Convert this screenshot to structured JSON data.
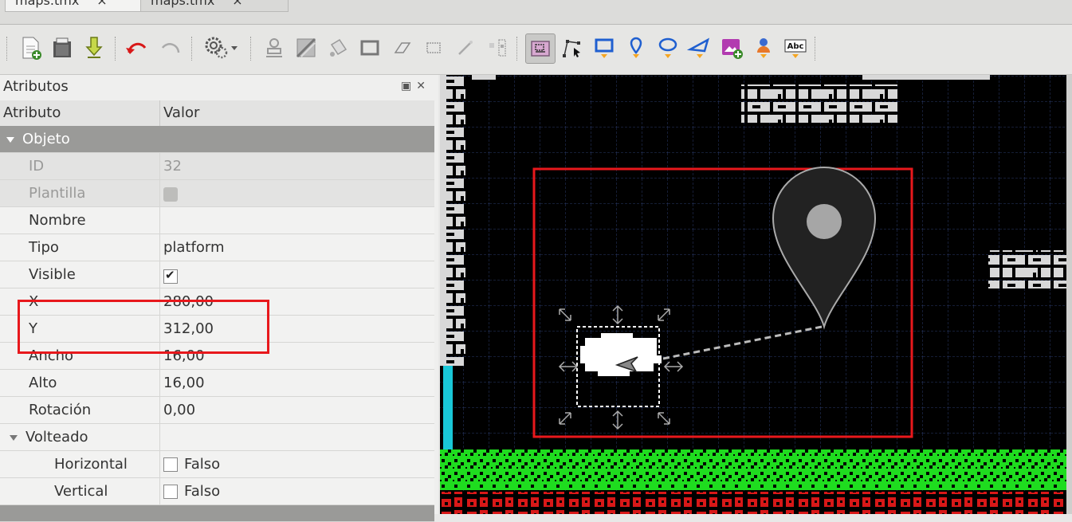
{
  "tabs": [
    {
      "label": "maps.tmx",
      "close": "×"
    },
    {
      "label": "maps.tmx",
      "close": "×"
    }
  ],
  "toolbar": {
    "icons": [
      "new-file-icon",
      "open-file-icon",
      "save-icon",
      "undo-icon",
      "redo-icon",
      "commands-icon",
      "stamp-icon",
      "terrain-icon",
      "bucket-fill-icon",
      "shape-fill-icon",
      "eraser-icon",
      "rect-select-icon",
      "magic-wand-icon",
      "select-same-tile-icon",
      "select-objects-icon",
      "edit-polygons-icon",
      "insert-rectangle-icon",
      "insert-point-icon",
      "insert-ellipse-icon",
      "insert-polygon-icon",
      "insert-tile-icon",
      "insert-template-icon",
      "insert-text-icon"
    ],
    "text_tool_label": "Abc"
  },
  "panel": {
    "title": "Atributos",
    "header": {
      "attribute": "Atributo",
      "value": "Valor"
    },
    "group_object": "Objeto",
    "rows": {
      "id": {
        "label": "ID",
        "value": "32"
      },
      "template": {
        "label": "Plantilla"
      },
      "name": {
        "label": "Nombre",
        "value": ""
      },
      "type": {
        "label": "Tipo",
        "value": "platform"
      },
      "visible": {
        "label": "Visible",
        "checked": true
      },
      "x": {
        "label": "X",
        "value": "280,00"
      },
      "y": {
        "label": "Y",
        "value": "312,00"
      },
      "width": {
        "label": "Ancho",
        "value": "16,00"
      },
      "height": {
        "label": "Alto",
        "value": "16,00"
      },
      "rotation": {
        "label": "Rotación",
        "value": "0,00"
      }
    },
    "group_flip": "Volteado",
    "flip": {
      "horizontal": {
        "label": "Horizontal",
        "value": "Falso"
      },
      "vertical": {
        "label": "Vertical",
        "value": "Falso"
      }
    }
  },
  "colors": {
    "highlight": "#e8181c",
    "ground_green": "#1fdc1f",
    "ground_red": "#d81818",
    "cyan_wall": "#19c8d8",
    "brick": "#d8d8d8"
  }
}
